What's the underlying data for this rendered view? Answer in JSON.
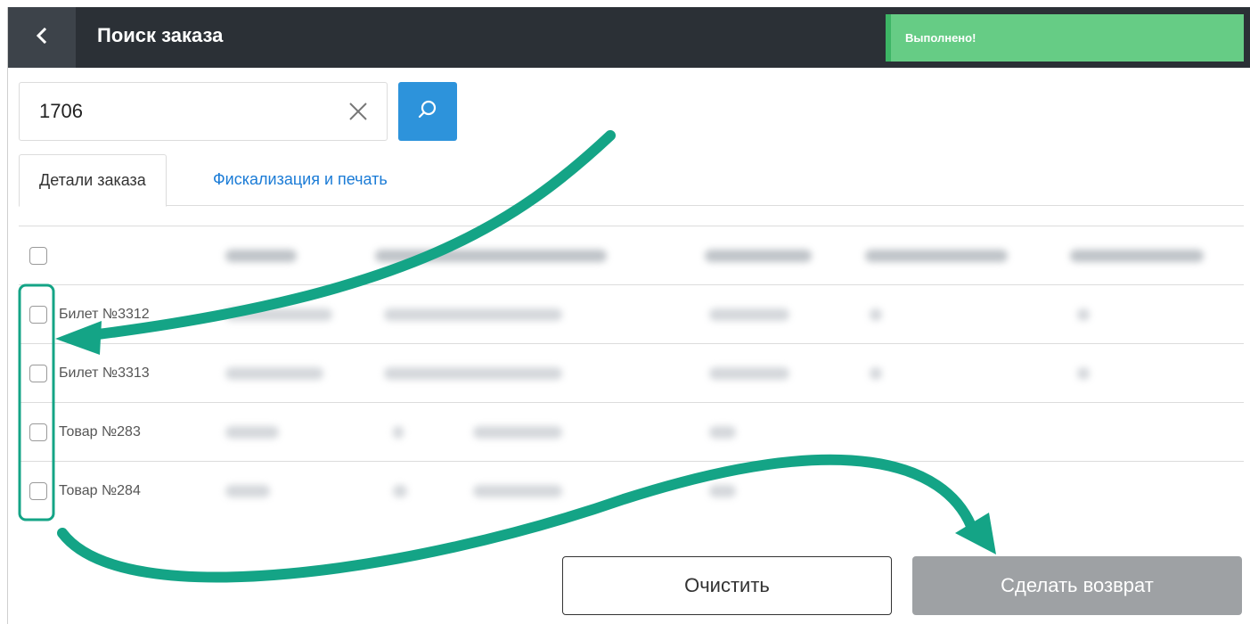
{
  "header": {
    "title": "Поиск заказа",
    "back_icon": "chevron-left-icon",
    "toast": "Выполнено!",
    "colors": {
      "bar": "#2b3036",
      "toast": "#66cc85"
    }
  },
  "search": {
    "value": "1706",
    "clear_icon": "close-icon",
    "button_icon": "search-icon",
    "button_color": "#2d93db"
  },
  "tabs": [
    {
      "label": "Детали заказа",
      "active": true
    },
    {
      "label": "Фискализация и печать",
      "active": false
    }
  ],
  "table": {
    "rows": [
      {
        "label": "Билет №3312"
      },
      {
        "label": "Билет №3313"
      },
      {
        "label": "Товар №283"
      },
      {
        "label": "Товар №284"
      }
    ]
  },
  "actions": {
    "clear_label": "Очистить",
    "return_label": "Сделать возврат",
    "return_color": "#9ea1a4"
  },
  "annotation_color": "#14a486"
}
